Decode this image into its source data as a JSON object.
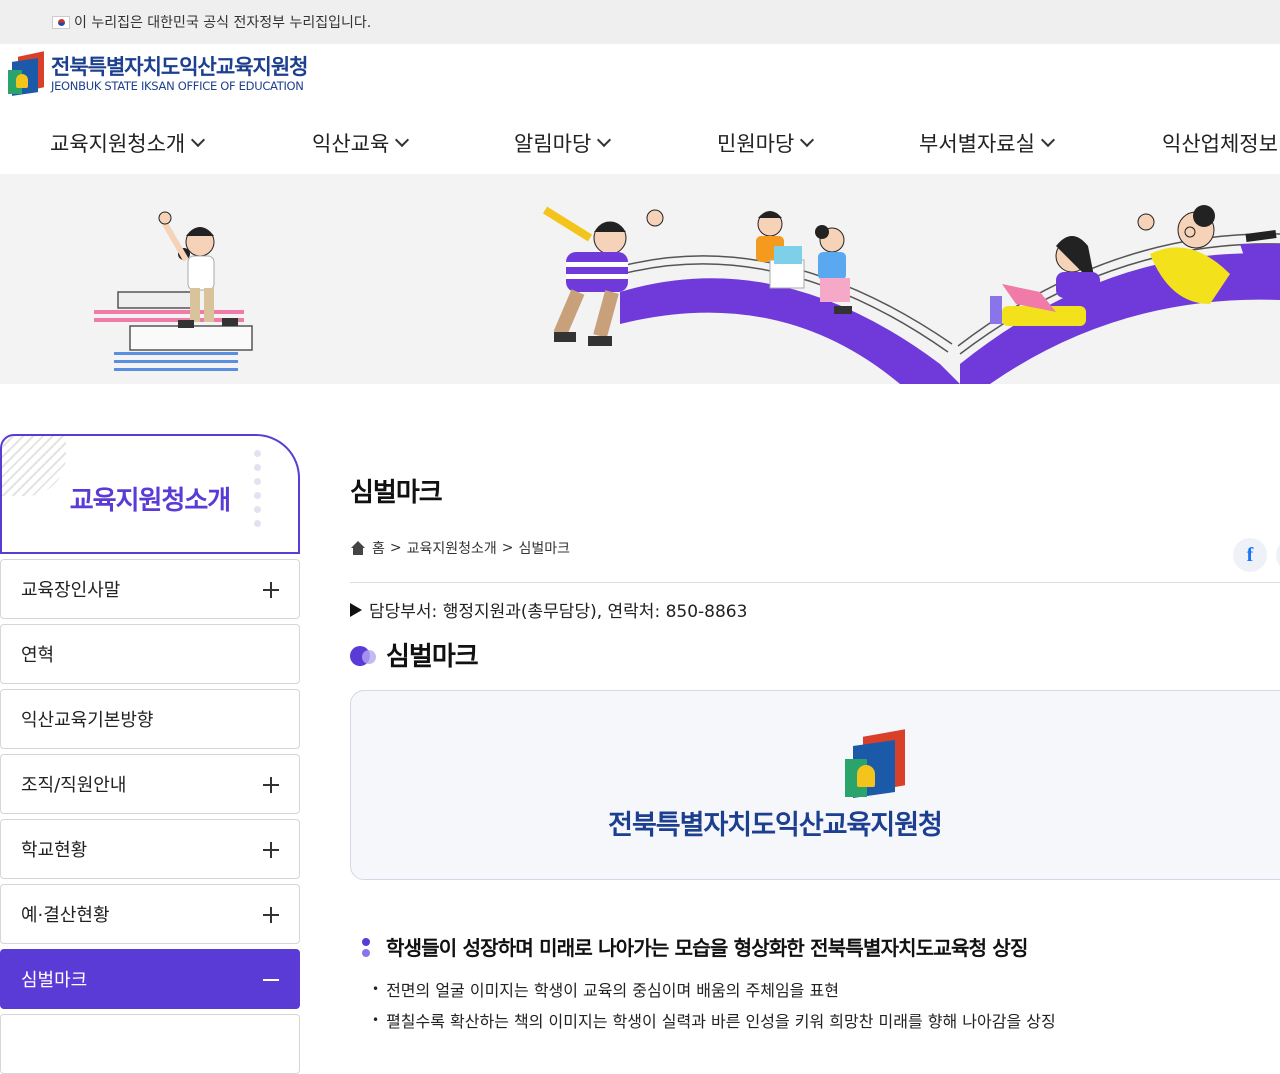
{
  "notice": {
    "text": "이 누리집은 대한민국 공식 전자정부 누리집입니다."
  },
  "header": {
    "logo_ko": "전북특별자치도익산교육지원청",
    "logo_en": "JEONBUK STATE IKSAN OFFICE OF EDUCATION"
  },
  "gnb": [
    {
      "label": "교육지원청소개"
    },
    {
      "label": "익산교육"
    },
    {
      "label": "알림마당"
    },
    {
      "label": "민원마당"
    },
    {
      "label": "부서별자료실"
    },
    {
      "label": "익산업체정보"
    }
  ],
  "sidebar": {
    "title": "교육지원청소개",
    "items": [
      {
        "label": "교육장인사말",
        "expandable": true
      },
      {
        "label": "연혁",
        "expandable": false
      },
      {
        "label": "익산교육기본방향",
        "expandable": false
      },
      {
        "label": "조직/직원안내",
        "expandable": true
      },
      {
        "label": "학교현황",
        "expandable": true
      },
      {
        "label": "예·결산현황",
        "expandable": true
      },
      {
        "label": "심벌마크",
        "active": true
      }
    ]
  },
  "content": {
    "page_title": "심벌마크",
    "breadcrumb": [
      "홈",
      "교육지원청소개",
      "심벌마크"
    ],
    "dept_info": "담당부서: 행정지원과(총무담당), 연락처: 850-8863",
    "section_title": "심벌마크",
    "symbol_text": "전북특별자치도익산교육지원청",
    "subheading": "학생들이 성장하며 미래로 나아가는 모습을 형상화한 전북특별자치도교육청 상징",
    "bullets": [
      "전면의 얼굴 이미지는 학생이 교육의 중심이며 배움의 주체임을 표현",
      "펼칠수록 확산하는 책의 이미지는 학생이 실력과 바른 인성을 키워 희망찬 미래를 향해 나아감을 상징"
    ],
    "share_label": "f"
  },
  "colors": {
    "accent": "#5a3bd6",
    "brand_blue": "#1d3f8f",
    "logo_red": "#d8402a",
    "logo_green": "#2aa46a",
    "logo_yellow": "#f3c51c"
  }
}
